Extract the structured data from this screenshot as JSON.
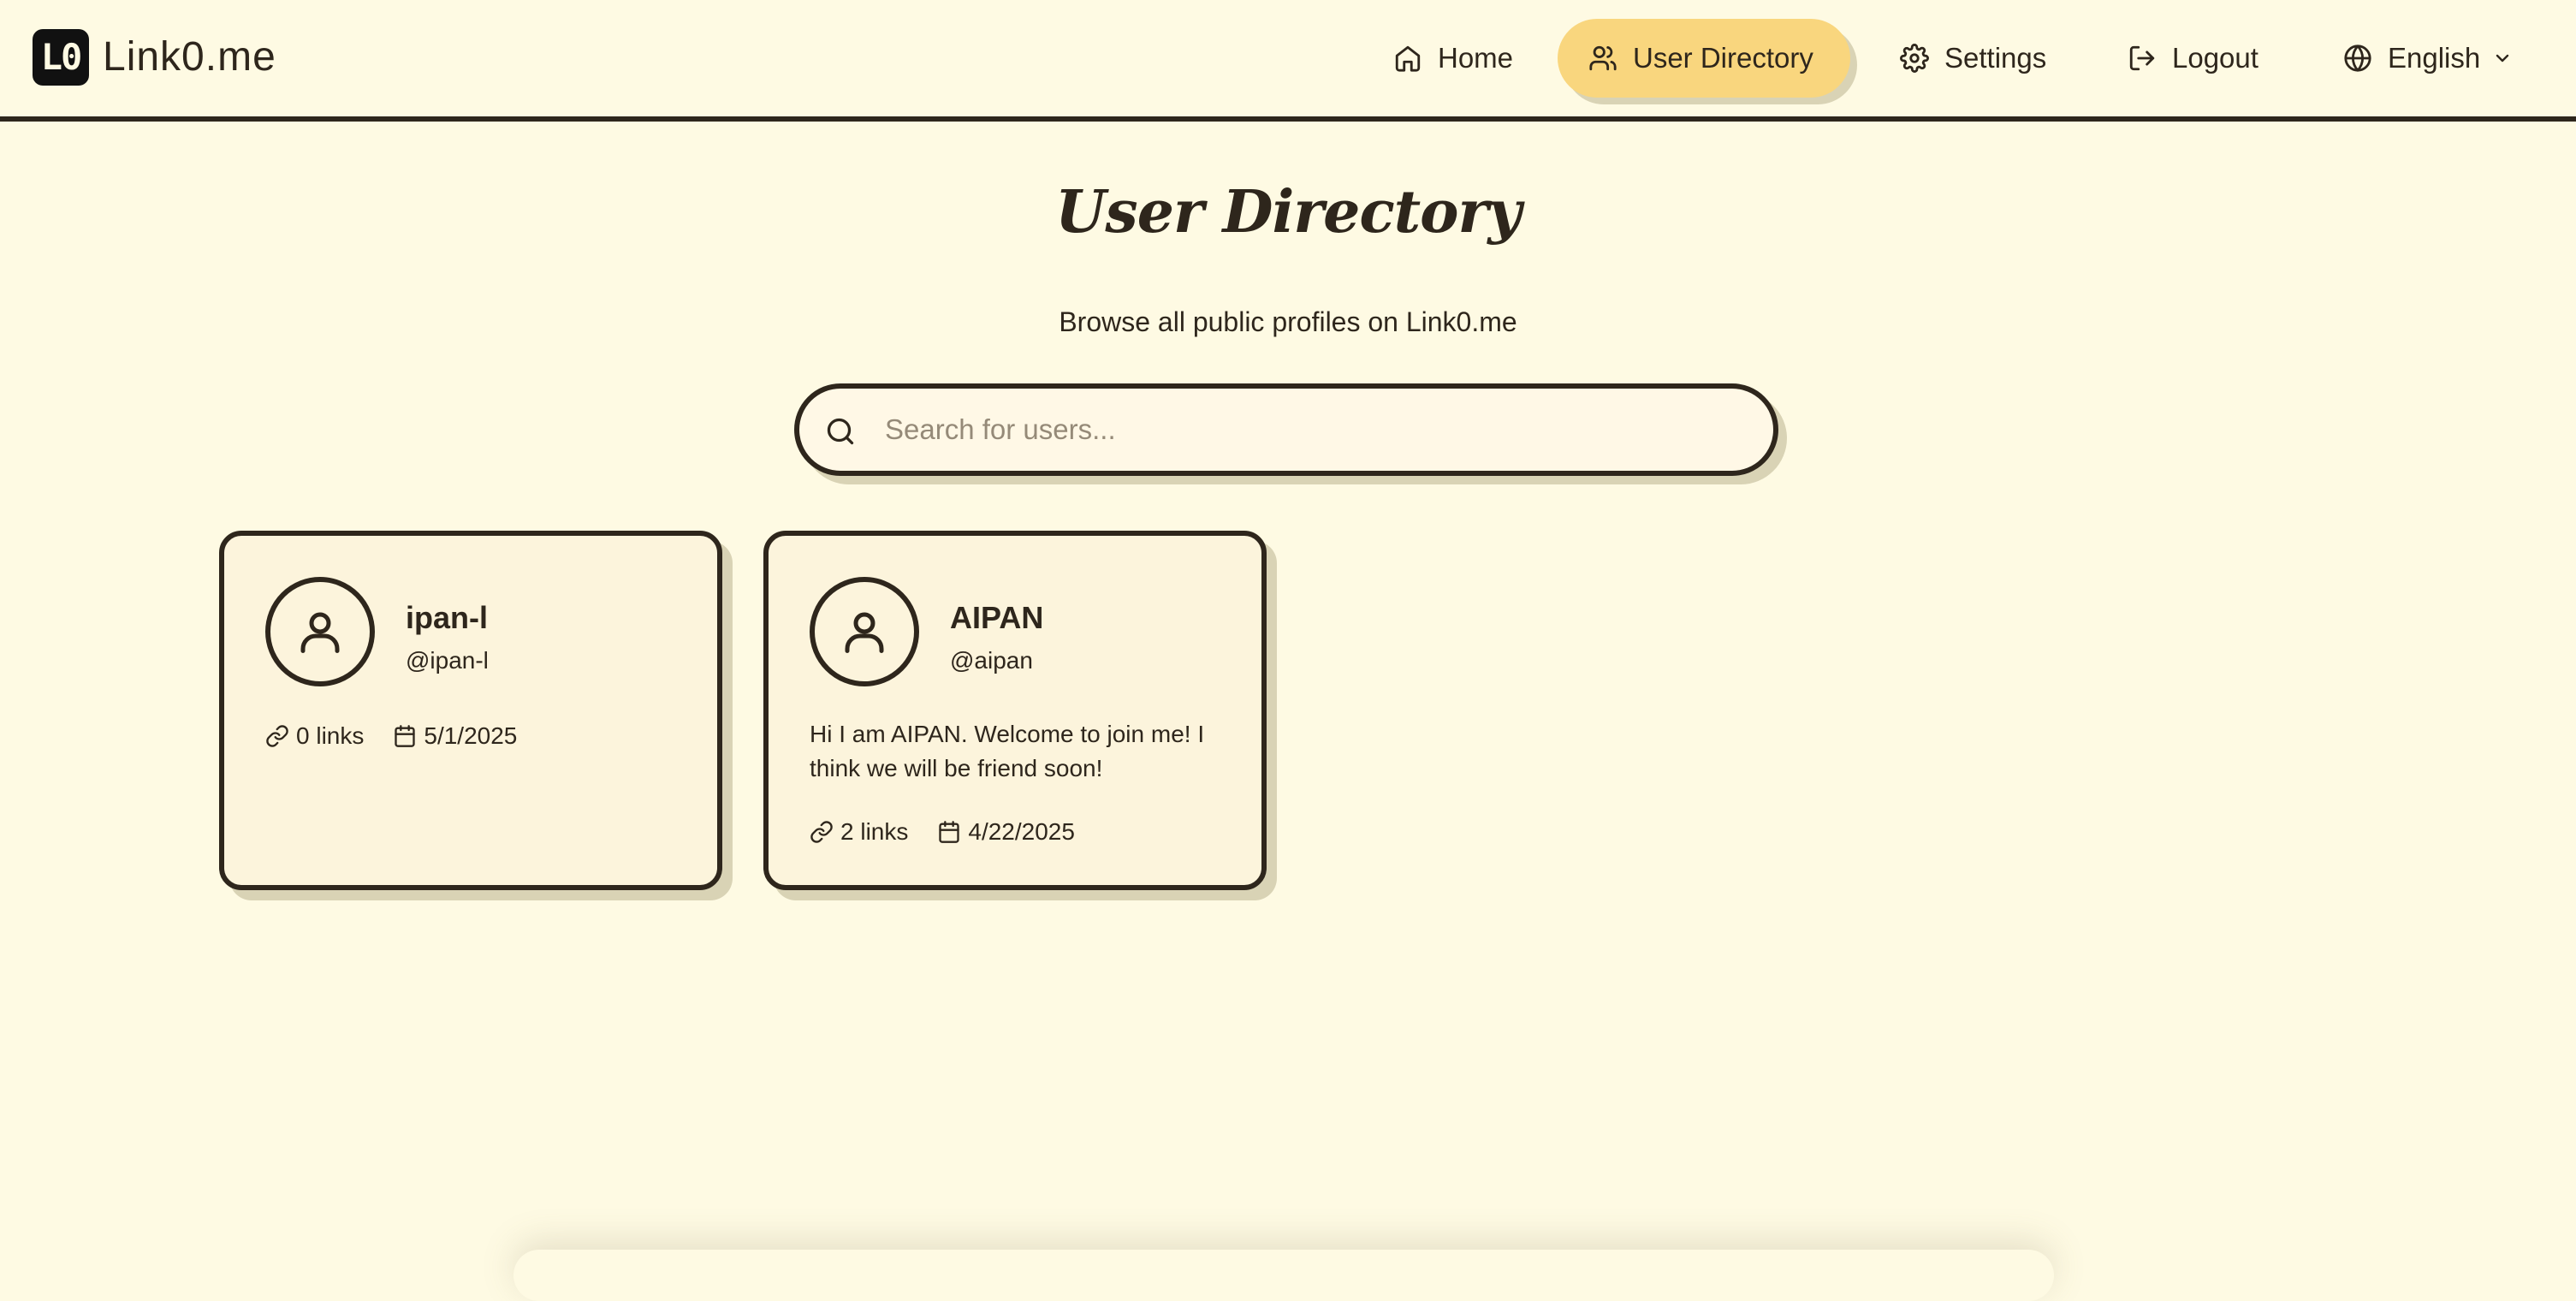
{
  "brand": {
    "logo_mark": "L0",
    "name": "Link0.me"
  },
  "nav": {
    "home": "Home",
    "directory": "User Directory",
    "settings": "Settings",
    "logout": "Logout",
    "language": "English"
  },
  "page": {
    "title": "User Directory",
    "subtitle": "Browse all public profiles on Link0.me"
  },
  "search": {
    "placeholder": "Search for users...",
    "value": ""
  },
  "users": [
    {
      "name": "ipan-l",
      "handle": "@ipan-l",
      "bio": "",
      "links": "0 links",
      "date": "5/1/2025"
    },
    {
      "name": "AIPAN",
      "handle": "@aipan",
      "bio": "Hi I am AIPAN. Welcome to join me! I think we will be friend soon!",
      "links": "2 links",
      "date": "4/22/2025"
    }
  ],
  "colors": {
    "background": "#fefae3",
    "ink": "#2e261c",
    "active_nav": "#f9d67e",
    "card_bg": "#fcf4dc",
    "shadow": "#d9d3b5"
  }
}
